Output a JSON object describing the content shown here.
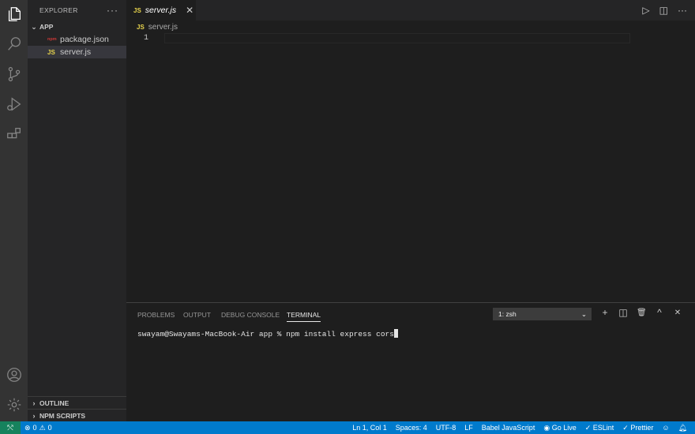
{
  "colors": {
    "accent": "#007acc",
    "remote": "#16825d",
    "js_icon": "#e8d44d",
    "npm_icon": "#cb3837"
  },
  "activity": {
    "icons": [
      "files-icon",
      "search-icon",
      "source-control-icon",
      "run-debug-icon",
      "extensions-icon",
      "account-icon",
      "gear-icon"
    ]
  },
  "sidebar": {
    "title": "EXPLORER",
    "more": "···",
    "folder": "APP",
    "files": [
      {
        "icon": "npm",
        "name": "package.json"
      },
      {
        "icon": "JS",
        "name": "server.js"
      }
    ],
    "outline": "OUTLINE",
    "npm_scripts": "NPM SCRIPTS"
  },
  "tabs": {
    "active": {
      "icon": "JS",
      "name": "server.js",
      "close": "✕"
    }
  },
  "editor_actions": {
    "run": "▷",
    "split": "◫",
    "more": "···"
  },
  "breadcrumb": {
    "icon": "JS",
    "file": "server.js"
  },
  "editor": {
    "line_number": "1"
  },
  "panel": {
    "tabs": [
      "PROBLEMS",
      "OUTPUT",
      "DEBUG CONSOLE",
      "TERMINAL"
    ],
    "active_tab": "TERMINAL",
    "terminal_select": "1: zsh",
    "actions": {
      "add": "+",
      "split": "◫",
      "trash": "🗑",
      "maximize": "^",
      "close": "✕"
    },
    "terminal_text": "swayam@Swayams-MacBook-Air app % npm install express cors"
  },
  "status": {
    "remote": "⤲",
    "errors": "0",
    "warnings": "0",
    "position": "Ln 1, Col 1",
    "spaces": "Spaces: 4",
    "encoding": "UTF-8",
    "eol": "LF",
    "language": "Babel JavaScript",
    "golive": "Go Live",
    "eslint": "ESLint",
    "prettier": "Prettier"
  }
}
